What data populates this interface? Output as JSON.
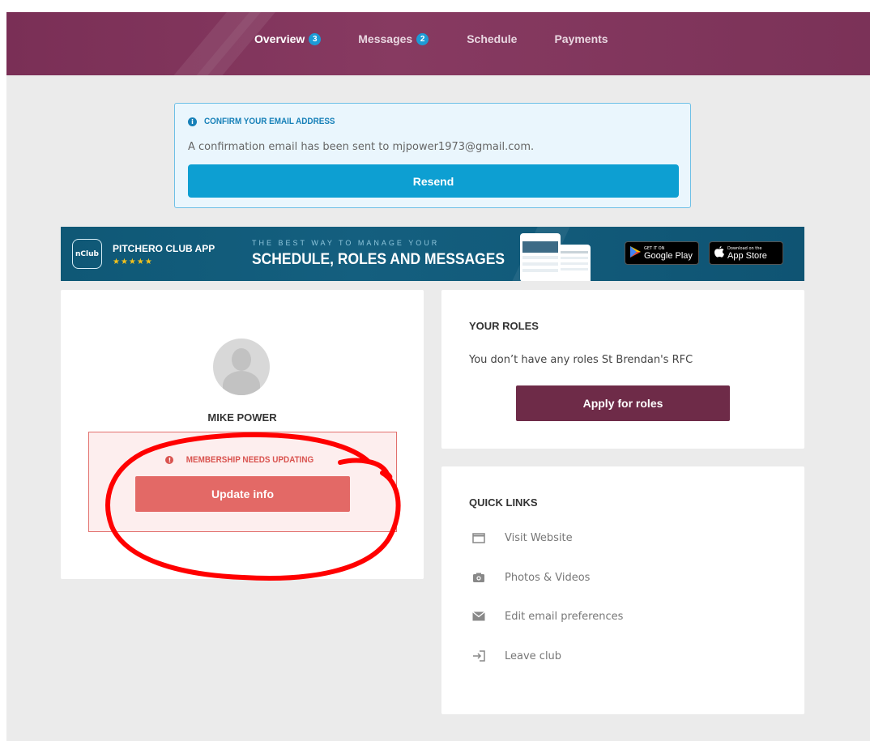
{
  "nav": {
    "tabs": [
      {
        "label": "Overview",
        "badge": "3"
      },
      {
        "label": "Messages",
        "badge": "2"
      },
      {
        "label": "Schedule"
      },
      {
        "label": "Payments"
      }
    ]
  },
  "email_alert": {
    "title": "CONFIRM YOUR EMAIL ADDRESS",
    "message": "A confirmation email has been sent to mjpower1973@gmail.com.",
    "button": "Resend"
  },
  "app_banner": {
    "logo_text": "nClub",
    "app_name": "PITCHERO CLUB APP",
    "stars": "★★★★★",
    "tagline_small": "THE BEST WAY TO MANAGE YOUR",
    "tagline_big": "SCHEDULE, ROLES AND MESSAGES",
    "google_small": "GET IT ON",
    "google_big": "Google Play",
    "apple_small": "Download on the",
    "apple_big": "App Store"
  },
  "profile": {
    "name": "MIKE POWER",
    "membership_warning": "MEMBERSHIP NEEDS UPDATING",
    "update_button": "Update info"
  },
  "roles": {
    "title": "YOUR ROLES",
    "text": "You don’t have any roles St Brendan's RFC",
    "button": "Apply for roles"
  },
  "quick_links": {
    "title": "QUICK LINKS",
    "items": [
      {
        "label": "Visit Website",
        "icon": "window-icon"
      },
      {
        "label": "Photos & Videos",
        "icon": "camera-icon"
      },
      {
        "label": "Edit email preferences",
        "icon": "envelope-icon"
      },
      {
        "label": "Leave club",
        "icon": "exit-icon"
      }
    ]
  },
  "colors": {
    "nav_bg": "#7f355b",
    "info_blue": "#0d9fd2",
    "warning_red": "#e36966",
    "apply_purple": "#6e2b48",
    "annotation_red": "#ff0000"
  }
}
